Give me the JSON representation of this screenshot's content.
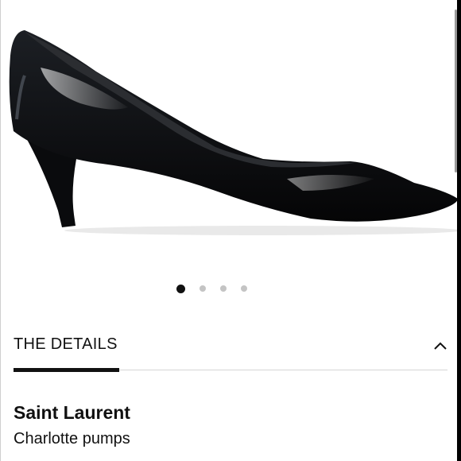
{
  "gallery": {
    "image_name": "black patent kitten-heel pump",
    "dots_total": 4,
    "active_index": 0
  },
  "details": {
    "title": "THE DETAILS",
    "state": "expanded"
  },
  "product": {
    "brand": "Saint Laurent",
    "name": "Charlotte pumps"
  }
}
